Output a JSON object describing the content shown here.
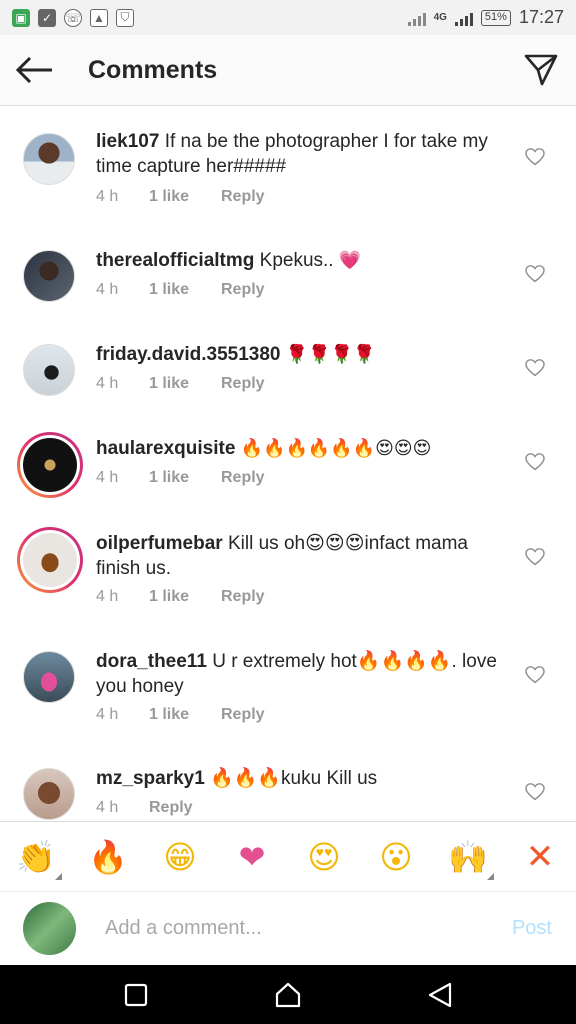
{
  "status_bar": {
    "network": "4G",
    "battery": "51%",
    "time": "17:27"
  },
  "header": {
    "title": "Comments"
  },
  "comments": [
    {
      "username": "liek107",
      "text": "If na be the photographer I for take my time capture her#####",
      "time": "4 h",
      "likes": "1 like",
      "reply": "Reply"
    },
    {
      "username": "therealofficialtmg",
      "text": "Kpekus.. ",
      "emoji": "💗",
      "time": "4 h",
      "likes": "1 like",
      "reply": "Reply"
    },
    {
      "username": "friday.david.3551380",
      "text": "",
      "emoji": "🌹🌹🌹🌹",
      "time": "4 h",
      "likes": "1 like",
      "reply": "Reply"
    },
    {
      "username": "haularexquisite",
      "text": "",
      "emoji": "🔥🔥🔥🔥🔥🔥😍😍😍",
      "time": "4 h",
      "likes": "1 like",
      "reply": "Reply"
    },
    {
      "username": "oilperfumebar",
      "text": "Kill us oh😍😍😍infact mama finish us.",
      "time": "4 h",
      "likes": "1 like",
      "reply": "Reply"
    },
    {
      "username": "dora_thee11",
      "text": "U r extremely hot🔥🔥🔥🔥. love you honey",
      "time": "4 h",
      "likes": "1 like",
      "reply": "Reply"
    },
    {
      "username": "mz_sparky1",
      "text": "🔥🔥🔥kuku Kill us",
      "time": "4 h",
      "likes": "",
      "reply": "Reply"
    }
  ],
  "emoji_bar": [
    "👏",
    "🔥",
    "😁",
    "❤",
    "😍",
    "😮",
    "🙌",
    "✕"
  ],
  "add_comment": {
    "placeholder": "Add a comment...",
    "post_label": "Post"
  },
  "colors": {
    "post_disabled": "#b2dffc",
    "meta_gray": "#999999",
    "text": "#262626"
  }
}
